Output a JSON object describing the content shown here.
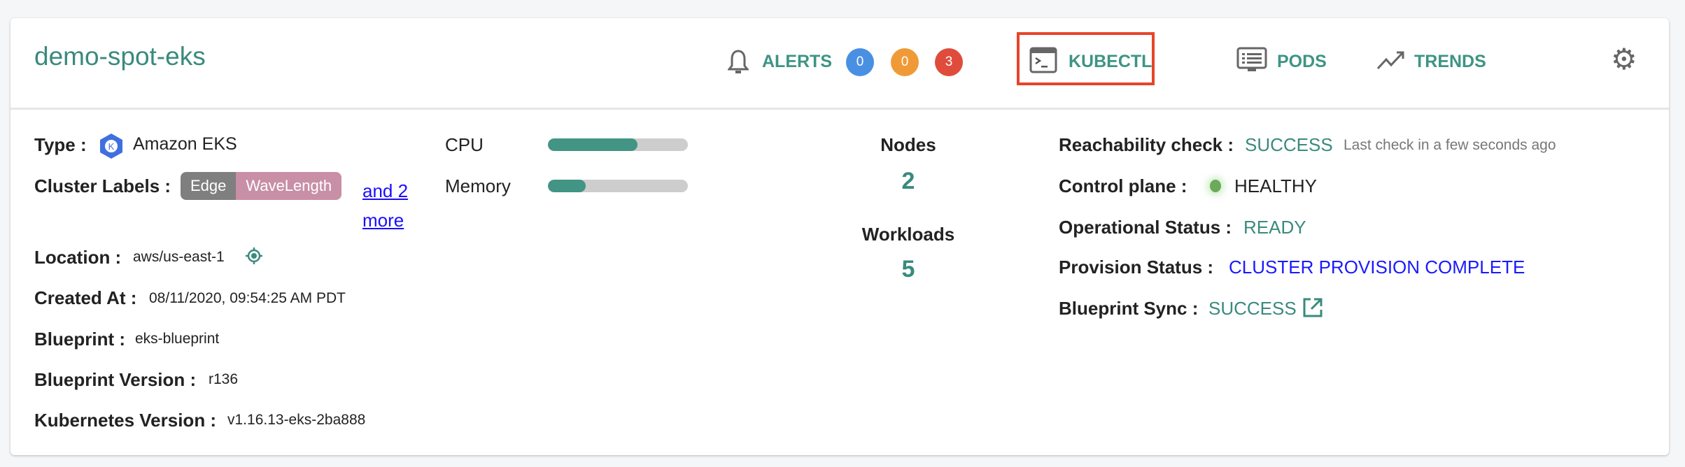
{
  "header": {
    "title": "demo-spot-eks",
    "alerts": {
      "label": "ALERTS",
      "counts": [
        "0",
        "0",
        "3"
      ],
      "colors": [
        "#4a90e2",
        "#f09a37",
        "#e04c3c"
      ]
    },
    "kubectl": "KUBECTL",
    "pods": "PODS",
    "trends": "TRENDS"
  },
  "details": {
    "type": {
      "label": "Type :",
      "value": "Amazon EKS"
    },
    "cluster_labels": {
      "label": "Cluster Labels :",
      "tags": [
        "Edge",
        "WaveLength"
      ],
      "more": "and 2 more"
    },
    "location": {
      "label": "Location :",
      "value": "aws/us-east-1"
    },
    "created_at": {
      "label": "Created At :",
      "value": "08/11/2020, 09:54:25 AM PDT"
    },
    "blueprint": {
      "label": "Blueprint :",
      "value": "eks-blueprint"
    },
    "blueprint_version": {
      "label": "Blueprint Version :",
      "value": "r136"
    },
    "kubernetes_version": {
      "label": "Kubernetes Version :",
      "value": "v1.16.13-eks-2ba888"
    }
  },
  "usage": {
    "cpu": {
      "label": "CPU",
      "percent": 64
    },
    "memory": {
      "label": "Memory",
      "percent": 27
    }
  },
  "counts": {
    "nodes": {
      "label": "Nodes",
      "value": "2"
    },
    "workloads": {
      "label": "Workloads",
      "value": "5"
    }
  },
  "status": {
    "reachability": {
      "label": "Reachability check :",
      "value": "SUCCESS",
      "note": "Last check in a few seconds ago"
    },
    "control_plane": {
      "label": "Control plane :",
      "value": "HEALTHY"
    },
    "operational": {
      "label": "Operational Status :",
      "value": "READY"
    },
    "provision": {
      "label": "Provision Status :",
      "value": "CLUSTER PROVISION COMPLETE"
    },
    "blueprint_sync": {
      "label": "Blueprint Sync :",
      "value": "SUCCESS"
    }
  }
}
